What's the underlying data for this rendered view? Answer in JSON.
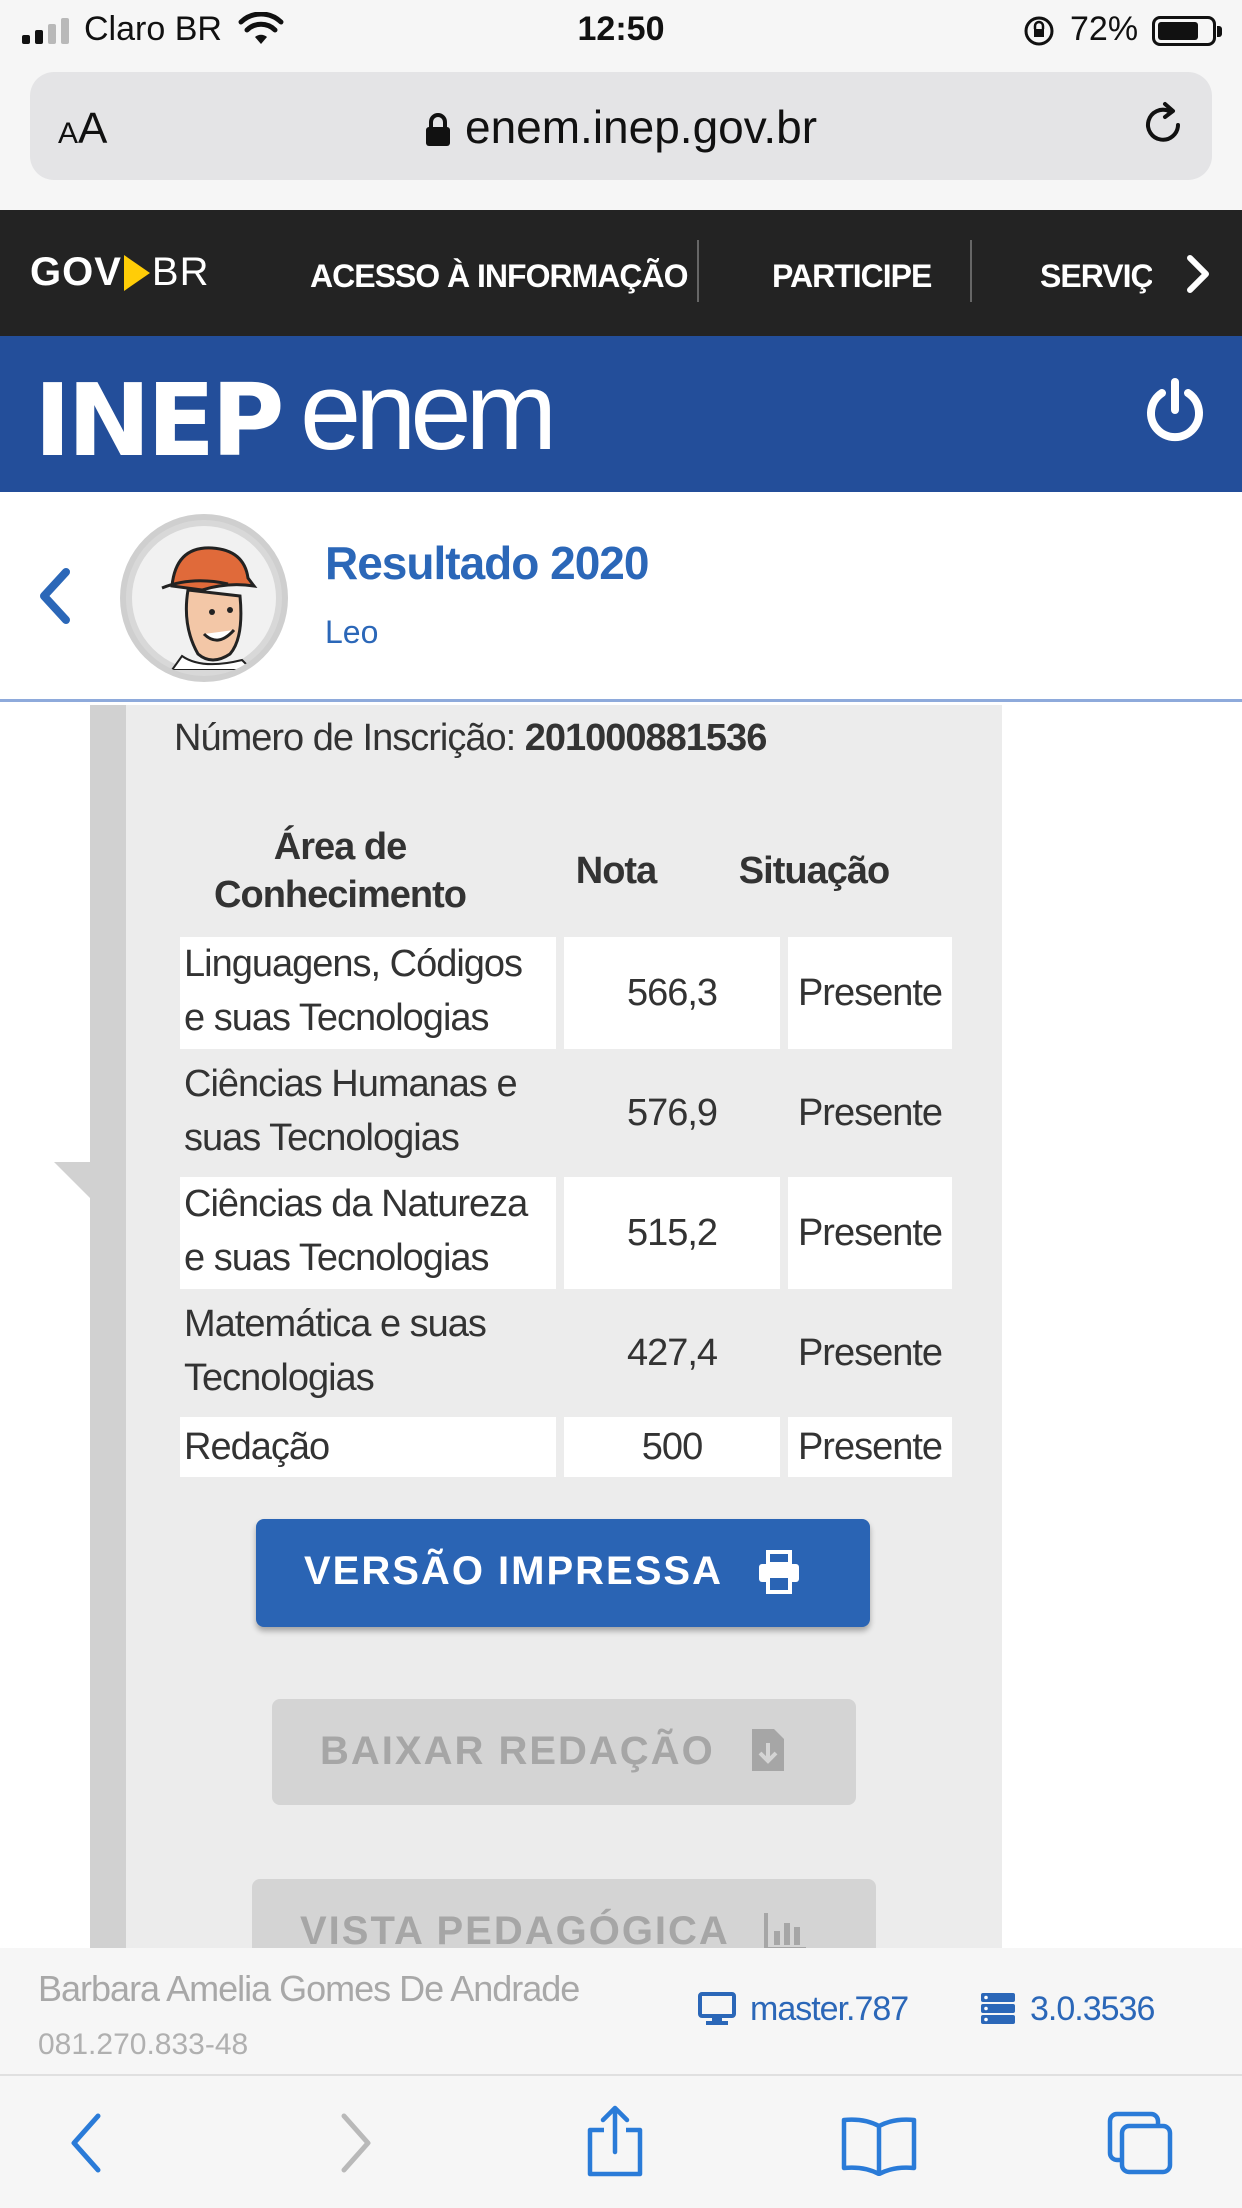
{
  "status_bar": {
    "carrier": "Claro BR",
    "time": "12:50",
    "battery": "72%",
    "icons": [
      "signal-icon",
      "wifi-icon",
      "rotation-lock-icon",
      "battery-icon"
    ]
  },
  "browser": {
    "text_size_label_small": "A",
    "text_size_label_large": "A",
    "url": "enem.inep.gov.br"
  },
  "gov_nav": {
    "logo_gov": "GOV",
    "logo_br": "BR",
    "links": [
      "ACESSO À INFORMAÇÃO",
      "PARTICIPE",
      "SERVIÇOS"
    ]
  },
  "header": {
    "inep_logo": "INEP",
    "enem_logo": "enem"
  },
  "profile": {
    "title": "Resultado 2020",
    "name": "Leo"
  },
  "results": {
    "inscricao_label": "Número de Inscrição:",
    "inscricao_value": "201000881536",
    "headers": {
      "area_line1": "Área de",
      "area_line2": "Conhecimento",
      "nota": "Nota",
      "situacao": "Situação"
    },
    "rows": [
      {
        "area_line1": "Linguagens, Códigos",
        "area_line2": "e suas Tecnologias",
        "nota": "566,3",
        "situacao": "Presente"
      },
      {
        "area_line1": "Ciências Humanas e",
        "area_line2": "suas Tecnologias",
        "nota": "576,9",
        "situacao": "Presente"
      },
      {
        "area_line1": "Ciências da Natureza",
        "area_line2": "e suas Tecnologias",
        "nota": "515,2",
        "situacao": "Presente"
      },
      {
        "area_line1": "Matemática e suas",
        "area_line2": "Tecnologias",
        "nota": "427,4",
        "situacao": "Presente"
      },
      {
        "area_line1": "Redação",
        "area_line2": "",
        "nota": "500",
        "situacao": "Presente"
      }
    ]
  },
  "buttons": {
    "print": "VERSÃO IMPRESSA",
    "download": "BAIXAR REDAÇÃO",
    "pedagogica": "VISTA PEDAGÓGICA"
  },
  "footer_info": {
    "user_name": "Barbara Amelia Gomes De Andrade",
    "cpf": "081.270.833-48",
    "server": "master.787",
    "version": "3.0.3536"
  },
  "colors": {
    "brand_blue": "#234e9a",
    "link_blue": "#2b67b8",
    "gov_bar": "#232323",
    "gov_yellow": "#ffcd07"
  }
}
